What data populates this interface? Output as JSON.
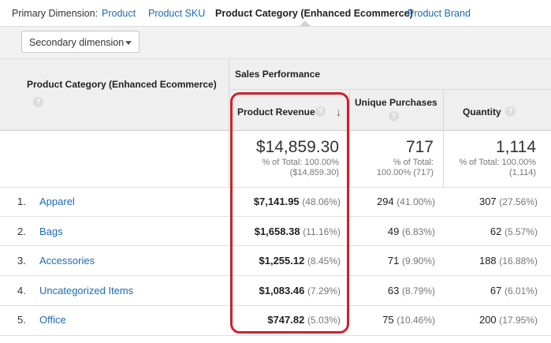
{
  "dimension_bar": {
    "label": "Primary Dimension:",
    "options": [
      {
        "label": "Product",
        "active": false
      },
      {
        "label": "Product SKU",
        "active": false
      },
      {
        "label": "Product Category (Enhanced Ecommerce)",
        "active": true
      },
      {
        "label": "Product Brand",
        "active": false
      }
    ]
  },
  "toolbar": {
    "secondary_dimension": "Secondary dimension"
  },
  "table": {
    "dimension_header": "Product Category (Enhanced Ecommerce)",
    "group_header": "Sales Performance",
    "columns": {
      "revenue": "Product Revenue",
      "purchases": "Unique Purchases",
      "quantity": "Quantity"
    },
    "help_glyph": "?",
    "sort_glyph": "↓",
    "totals": {
      "revenue": {
        "value": "$14,859.30",
        "line1": "% of Total: 100.00%",
        "line2": "($14,859.30)"
      },
      "purchases": {
        "value": "717",
        "line1": "% of Total:",
        "line2": "100.00% (717)"
      },
      "quantity": {
        "value": "1,114",
        "line1": "% of Total: 100.00%",
        "line2": "(1,114)"
      }
    },
    "rows": [
      {
        "num": "1.",
        "name": "Apparel",
        "revenue": "$7,141.95",
        "revenue_pct": "(48.06%)",
        "purchases": "294",
        "purchases_pct": "(41.00%)",
        "quantity": "307",
        "quantity_pct": "(27.56%)"
      },
      {
        "num": "2.",
        "name": "Bags",
        "revenue": "$1,658.38",
        "revenue_pct": "(11.16%)",
        "purchases": "49",
        "purchases_pct": "(6.83%)",
        "quantity": "62",
        "quantity_pct": "(5.57%)"
      },
      {
        "num": "3.",
        "name": "Accessories",
        "revenue": "$1,255.12",
        "revenue_pct": "(8.45%)",
        "purchases": "71",
        "purchases_pct": "(9.90%)",
        "quantity": "188",
        "quantity_pct": "(16.88%)"
      },
      {
        "num": "4.",
        "name": "Uncategorized Items",
        "revenue": "$1,083.46",
        "revenue_pct": "(7.29%)",
        "purchases": "63",
        "purchases_pct": "(8.79%)",
        "quantity": "67",
        "quantity_pct": "(6.01%)"
      },
      {
        "num": "5.",
        "name": "Office",
        "revenue": "$747.82",
        "revenue_pct": "(5.03%)",
        "purchases": "75",
        "purchases_pct": "(10.46%)",
        "quantity": "200",
        "quantity_pct": "(17.95%)"
      }
    ]
  },
  "colors": {
    "link": "#1a6bb8",
    "highlight": "#d0202a",
    "header_bg": "#efefef"
  }
}
